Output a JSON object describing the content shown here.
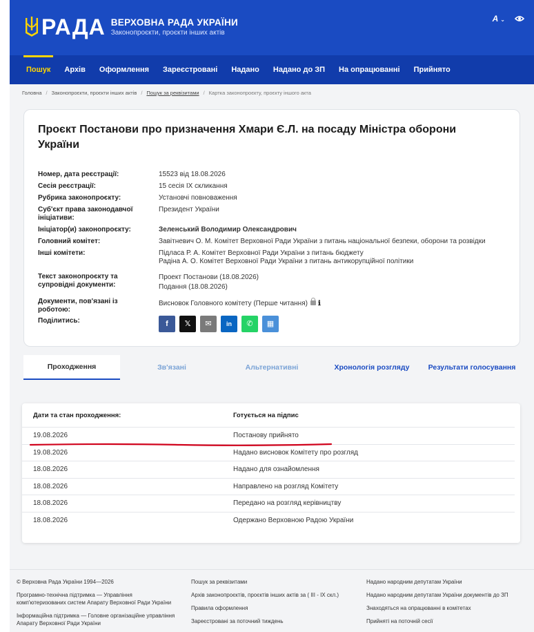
{
  "header": {
    "logo_word": "РАДА",
    "title": "ВЕРХОВНА РАДА УКРАЇНИ",
    "subtitle": "Законопроєкти, проєкти інших актів",
    "font_btn": "A",
    "font_caret": "⌄",
    "eye_icon": "eye-icon"
  },
  "nav": [
    "Пошук",
    "Архів",
    "Оформлення",
    "Зареєстровані",
    "Надано",
    "Надано до ЗП",
    "На опрацюванні",
    "Прийнято"
  ],
  "breadcrumbs": [
    "Головна",
    "Законопроєкти, проєкти інших актів",
    "Пошук за реквізитами",
    "Картка законопроєкту, проєкту іншого акта"
  ],
  "bill": {
    "title": "Проєкт Постанови про призначення Хмари Є.Л. на посаду Міністра оборони України",
    "rows": [
      {
        "k": "Номер, дата реєстрації:",
        "v": "15523 від 18.08.2026"
      },
      {
        "k": "Сесія реєстрації:",
        "v": "15 сесія IX скликання"
      },
      {
        "k": "Рубрика законопроєкту:",
        "v": "Установчі повноваження"
      },
      {
        "k": "Суб'єкт права законодавчої ініціативи:",
        "v": "Президент України"
      },
      {
        "k": "Ініціатор(и) законопроєкту:",
        "v": "Зеленський Володимир Олександрович"
      },
      {
        "k": "Головний комітет:",
        "v": "Завітневич О. М. Комітет Верховної Ради України з питань національної безпеки, оборони та розвідки"
      },
      {
        "k": "Інші комітети:",
        "v1": "Підласа Р. А. Комітет Верховної Ради України з питань бюджету",
        "v2": "Радіна А. О. Комітет Верховної Ради України з питань антикорупційної політики"
      },
      {
        "k": "Текст законопроєкту та супровідні документи:",
        "v1": "Проект Постанови (18.08.2026)",
        "v2": "Подання (18.08.2026)"
      },
      {
        "k": "Документи, пов'язані із роботою:",
        "v": "Висновок Головного комітету (Перше читання)"
      },
      {
        "k": "Поділитись:"
      }
    ],
    "share": [
      {
        "name": "facebook",
        "glyph": "f",
        "color": "#3b5998"
      },
      {
        "name": "x",
        "glyph": "𝕏",
        "color": "#111111"
      },
      {
        "name": "email",
        "glyph": "✉",
        "color": "#7a7a7a"
      },
      {
        "name": "linkedin",
        "glyph": "in",
        "color": "#0a66c2"
      },
      {
        "name": "whatsapp",
        "glyph": "✆",
        "color": "#25d366"
      },
      {
        "name": "qr",
        "glyph": "▦",
        "color": "#4a90d9"
      }
    ]
  },
  "tabs": [
    {
      "label": "Проходження",
      "color": "#333333"
    },
    {
      "label": "Зв'язані",
      "color": "#7aa3d6"
    },
    {
      "label": "Альтернативні",
      "color": "#7aa3d6"
    },
    {
      "label": "Хронологія розгляду",
      "color": "#1a4bc2"
    },
    {
      "label": "Результати голосування",
      "color": "#1a4bc2"
    }
  ],
  "passage": {
    "head_dates": "Дати та стан проходження:",
    "head_status": "Готується на підпис",
    "rows": [
      {
        "date": "19.08.2026",
        "status": "Постанову прийнято"
      },
      {
        "date": "19.08.2026",
        "status": "Надано висновок Комітету про розгляд"
      },
      {
        "date": "18.08.2026",
        "status": "Надано для ознайомлення"
      },
      {
        "date": "18.08.2026",
        "status": "Направлено на розгляд Комітету"
      },
      {
        "date": "18.08.2026",
        "status": "Передано на розгляд керівництву"
      },
      {
        "date": "18.08.2026",
        "status": "Одержано Верховною Радою України"
      }
    ]
  },
  "footer": {
    "col1": [
      "© Верховна Рада України 1994—2026",
      "Програмно-технічна підтримка — Управління комп'ютеризованих систем Апарату Верховної Ради України",
      "Інформаційна підтримка — Головне організаційне управління Апарату Верховної Ради України"
    ],
    "col2": [
      "Пошук за реквізитами",
      "Архів законопроєктів, проєктів інших актів за ( III - IX скл.)",
      "Правила оформлення",
      "Зареєстровані за поточний тиждень"
    ],
    "col3": [
      "Надано народним депутатам України",
      "Надано народним депутатам України документів до ЗП",
      "Знаходяться на опрацюванні в комітетах",
      "Прийняті на поточній сесії"
    ]
  }
}
